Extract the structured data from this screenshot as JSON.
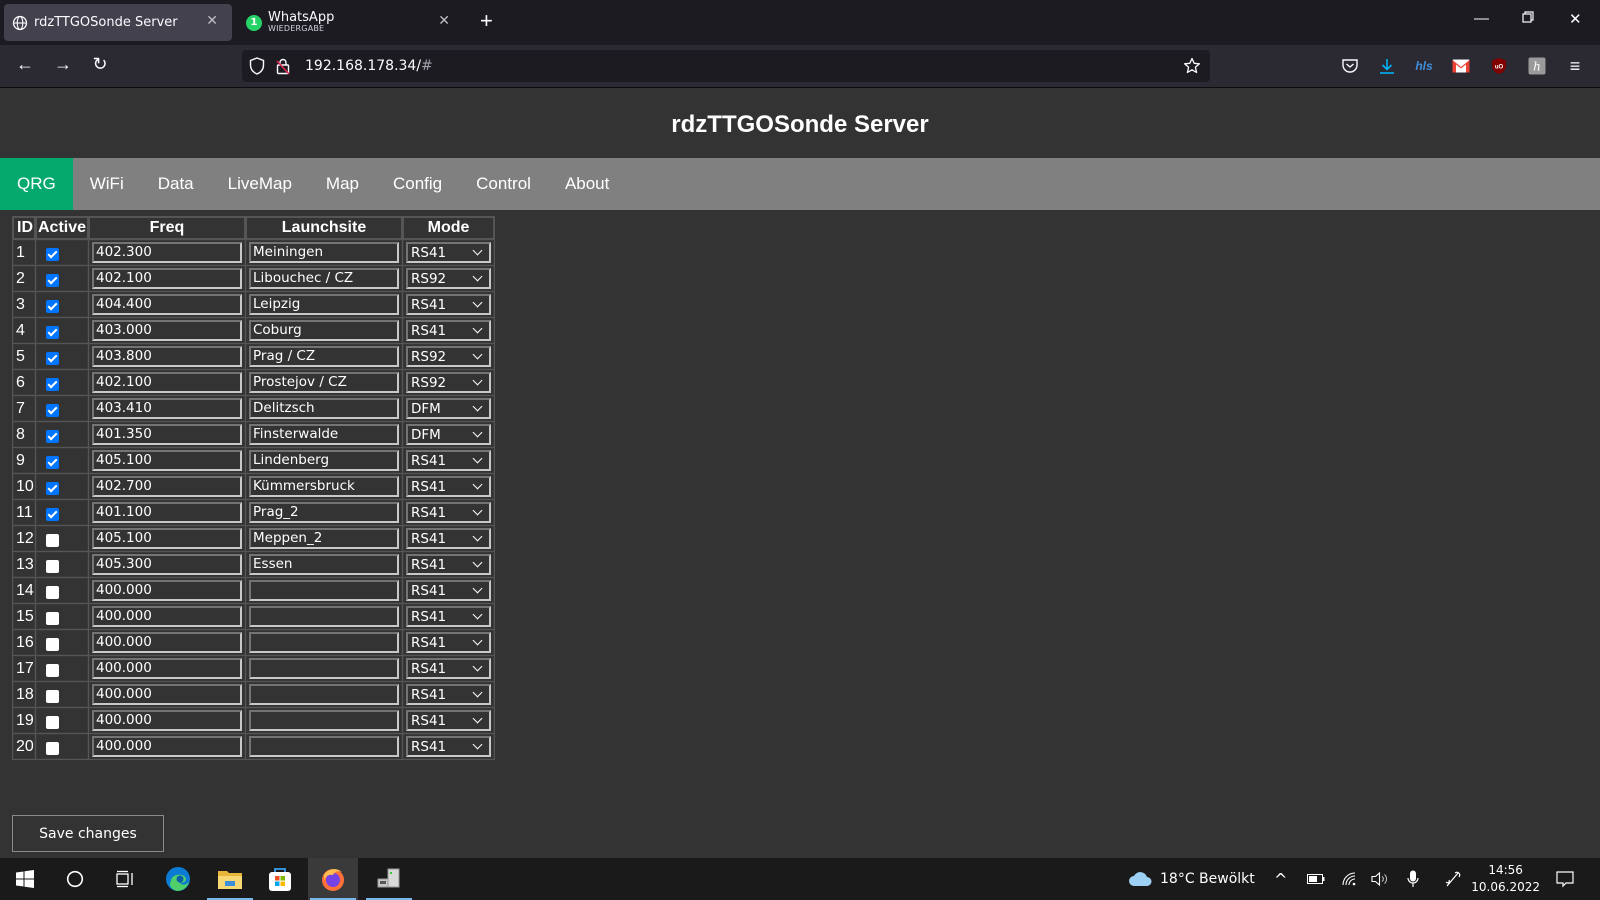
{
  "browser": {
    "tabs": [
      {
        "title": "rdzTTGOSonde Server",
        "icon": "globe-icon",
        "active": true
      },
      {
        "title": "WhatsApp",
        "subtitle": "WIEDERGABE",
        "icon": "whatsapp-icon",
        "badge": "1",
        "active": false
      }
    ],
    "url": "192.168.178.34/",
    "url_hash": "#"
  },
  "page": {
    "title": "rdzTTGOSonde Server",
    "menu": [
      {
        "label": "QRG",
        "active": true
      },
      {
        "label": "WiFi"
      },
      {
        "label": "Data"
      },
      {
        "label": "LiveMap"
      },
      {
        "label": "Map"
      },
      {
        "label": "Config"
      },
      {
        "label": "Control"
      },
      {
        "label": "About"
      }
    ],
    "table": {
      "headers": [
        "ID",
        "Active",
        "Freq",
        "Launchsite",
        "Mode"
      ],
      "rows": [
        {
          "id": "1",
          "active": true,
          "freq": "402.300",
          "site": "Meiningen",
          "mode": "RS41"
        },
        {
          "id": "2",
          "active": true,
          "freq": "402.100",
          "site": "Libouchec / CZ",
          "mode": "RS92"
        },
        {
          "id": "3",
          "active": true,
          "freq": "404.400",
          "site": "Leipzig",
          "mode": "RS41"
        },
        {
          "id": "4",
          "active": true,
          "freq": "403.000",
          "site": "Coburg",
          "mode": "RS41"
        },
        {
          "id": "5",
          "active": true,
          "freq": "403.800",
          "site": "Prag / CZ",
          "mode": "RS92"
        },
        {
          "id": "6",
          "active": true,
          "freq": "402.100",
          "site": "Prostejov / CZ",
          "mode": "RS92"
        },
        {
          "id": "7",
          "active": true,
          "freq": "403.410",
          "site": "Delitzsch",
          "mode": "DFM"
        },
        {
          "id": "8",
          "active": true,
          "freq": "401.350",
          "site": "Finsterwalde",
          "mode": "DFM"
        },
        {
          "id": "9",
          "active": true,
          "freq": "405.100",
          "site": "Lindenberg",
          "mode": "RS41"
        },
        {
          "id": "10",
          "active": true,
          "freq": "402.700",
          "site": "Kümmersbruck",
          "mode": "RS41"
        },
        {
          "id": "11",
          "active": true,
          "freq": "401.100",
          "site": "Prag_2",
          "mode": "RS41"
        },
        {
          "id": "12",
          "active": false,
          "freq": "405.100",
          "site": "Meppen_2",
          "mode": "RS41"
        },
        {
          "id": "13",
          "active": false,
          "freq": "405.300",
          "site": "Essen",
          "mode": "RS41"
        },
        {
          "id": "14",
          "active": false,
          "freq": "400.000",
          "site": "",
          "mode": "RS41"
        },
        {
          "id": "15",
          "active": false,
          "freq": "400.000",
          "site": "",
          "mode": "RS41"
        },
        {
          "id": "16",
          "active": false,
          "freq": "400.000",
          "site": "",
          "mode": "RS41"
        },
        {
          "id": "17",
          "active": false,
          "freq": "400.000",
          "site": "",
          "mode": "RS41"
        },
        {
          "id": "18",
          "active": false,
          "freq": "400.000",
          "site": "",
          "mode": "RS41"
        },
        {
          "id": "19",
          "active": false,
          "freq": "400.000",
          "site": "",
          "mode": "RS41"
        },
        {
          "id": "20",
          "active": false,
          "freq": "400.000",
          "site": "",
          "mode": "RS41"
        }
      ]
    },
    "save_label": "Save changes"
  },
  "taskbar": {
    "weather": "18°C  Bewölkt",
    "time": "14:56",
    "date": "10.06.2022"
  },
  "colors": {
    "accent": "#04aa6d",
    "menu_bg": "#808080",
    "page_bg": "#333333",
    "checkbox": "#0075ff"
  }
}
